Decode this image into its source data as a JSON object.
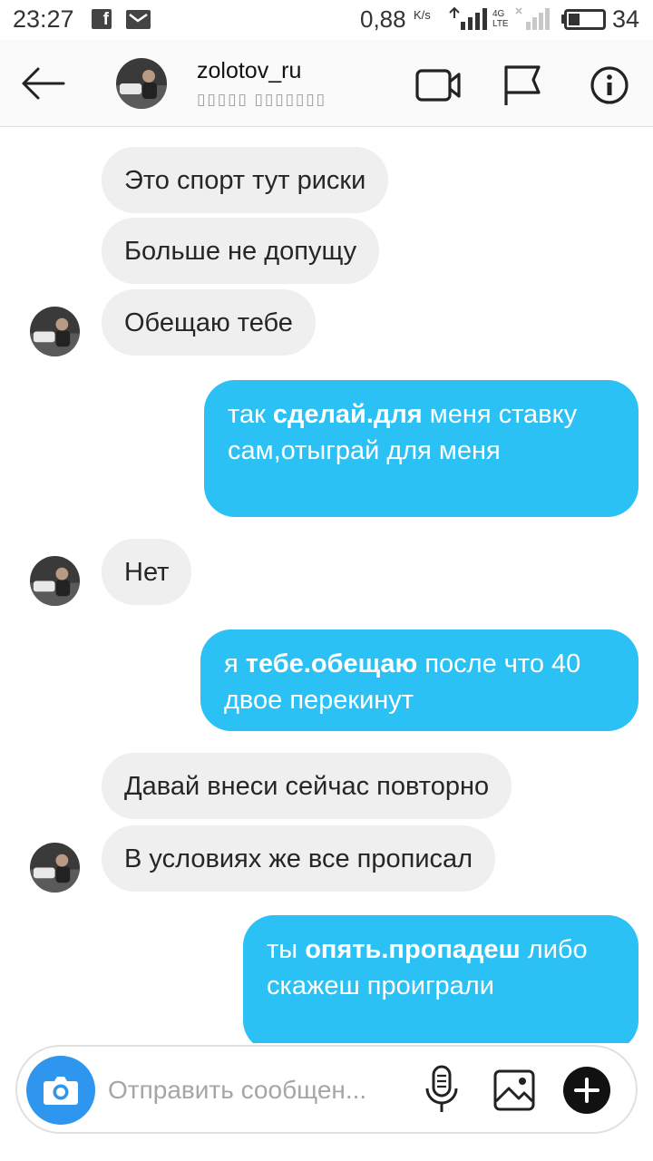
{
  "status_bar": {
    "time": "23:27",
    "speed": "0,88",
    "speed_unit": "K/s",
    "network": "4G\nLTE",
    "battery": "34",
    "battery_level": 0.34
  },
  "header": {
    "username": "zolotov_ru",
    "subtitle": "▯▯▯▯▯ ▯▯▯▯▯▯▯"
  },
  "messages": [
    {
      "from": "them",
      "text": "Это спорт тут риски"
    },
    {
      "from": "them",
      "text": "Больше не допущу"
    },
    {
      "from": "them",
      "text": "Обещаю тебе"
    },
    {
      "from": "me",
      "parts": [
        "так ",
        "сделай.для",
        " меня ставку",
        "сам,отыграй для меня"
      ]
    },
    {
      "from": "them",
      "text": "Нет"
    },
    {
      "from": "me",
      "parts": [
        "я ",
        "тебе.обещаю",
        " после что 40",
        "двое перекинут"
      ]
    },
    {
      "from": "them",
      "text": "Давай внеси сейчас повторно"
    },
    {
      "from": "them",
      "text": "В условиях же все прописал"
    },
    {
      "from": "me",
      "parts": [
        "ты ",
        "опять.пропадеш",
        " либо",
        "скажеш проиграли"
      ]
    }
  ],
  "composer": {
    "placeholder": "Отправить сообщен...",
    "value": ""
  },
  "colors": {
    "outgoing_bubble": "#2bc1f4",
    "incoming_bubble": "#efefef",
    "camera_button": "#2f96f0",
    "header_bg": "#fafafa"
  },
  "icons": [
    "back-arrow-icon",
    "video-call-icon",
    "flag-icon",
    "info-icon",
    "camera-icon",
    "microphone-icon",
    "gallery-icon",
    "plus-icon"
  ]
}
